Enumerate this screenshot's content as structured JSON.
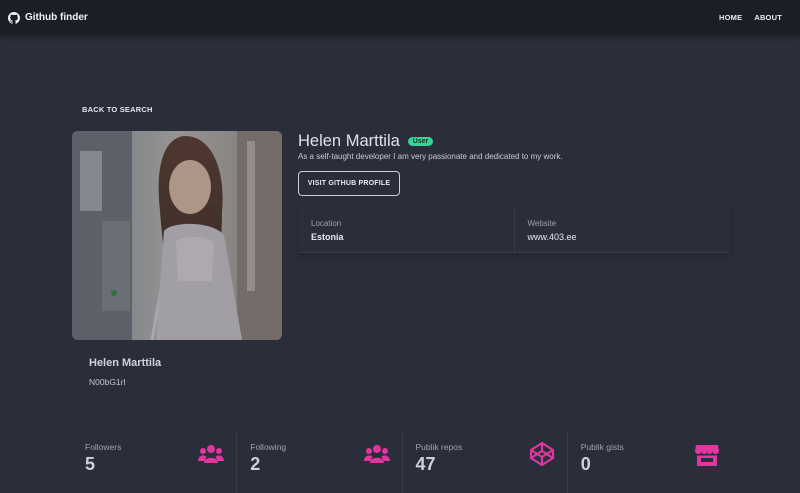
{
  "navbar": {
    "brand": "Github finder",
    "links": [
      "HOME",
      "ABOUT"
    ]
  },
  "back_link": "BACK TO SEARCH",
  "profile": {
    "name": "Helen Marttila",
    "type_badge": "User",
    "bio": "As a self-taught developer I am very passionate and dedicated to my work.",
    "visit_button": "VISIT GITHUB PROFILE",
    "card_name": "Helen Marttila",
    "login": "N00bG1rl"
  },
  "info": [
    {
      "label": "Location",
      "value": "Estonia"
    },
    {
      "label": "Website",
      "value": "www.403.ee"
    }
  ],
  "stats": [
    {
      "title": "Followers",
      "value": "5",
      "icon": "users-icon"
    },
    {
      "title": "Following",
      "value": "2",
      "icon": "users-icon"
    },
    {
      "title": "Publik repos",
      "value": "47",
      "icon": "codepen-icon"
    },
    {
      "title": "Publik gists",
      "value": "0",
      "icon": "store-icon"
    }
  ],
  "colors": {
    "background": "#2a2e3a",
    "navbar": "#1b1e25",
    "accent_icon": "#e1359f",
    "badge": "#36d399"
  }
}
